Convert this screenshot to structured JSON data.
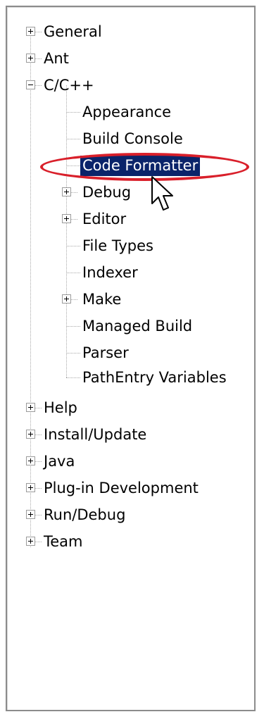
{
  "tree": {
    "general": "General",
    "ant": "Ant",
    "cpp": "C/C++",
    "appearance": "Appearance",
    "build_console": "Build Console",
    "code_formatter": "Code Formatter",
    "debug": "Debug",
    "editor": "Editor",
    "file_types": "File Types",
    "indexer": "Indexer",
    "make": "Make",
    "managed_build": "Managed Build",
    "parser": "Parser",
    "pathentry_variables": "PathEntry Variables",
    "help": "Help",
    "install_update": "Install/Update",
    "java": "Java",
    "plugin_development": "Plug-in Development",
    "run_debug": "Run/Debug",
    "team": "Team"
  },
  "icons": {
    "expand": "plus-box-icon",
    "collapse": "minus-box-icon",
    "cursor": "mouse-pointer-icon"
  },
  "colors": {
    "selection": "#0a246a",
    "highlight_oval": "#d91f2a"
  }
}
